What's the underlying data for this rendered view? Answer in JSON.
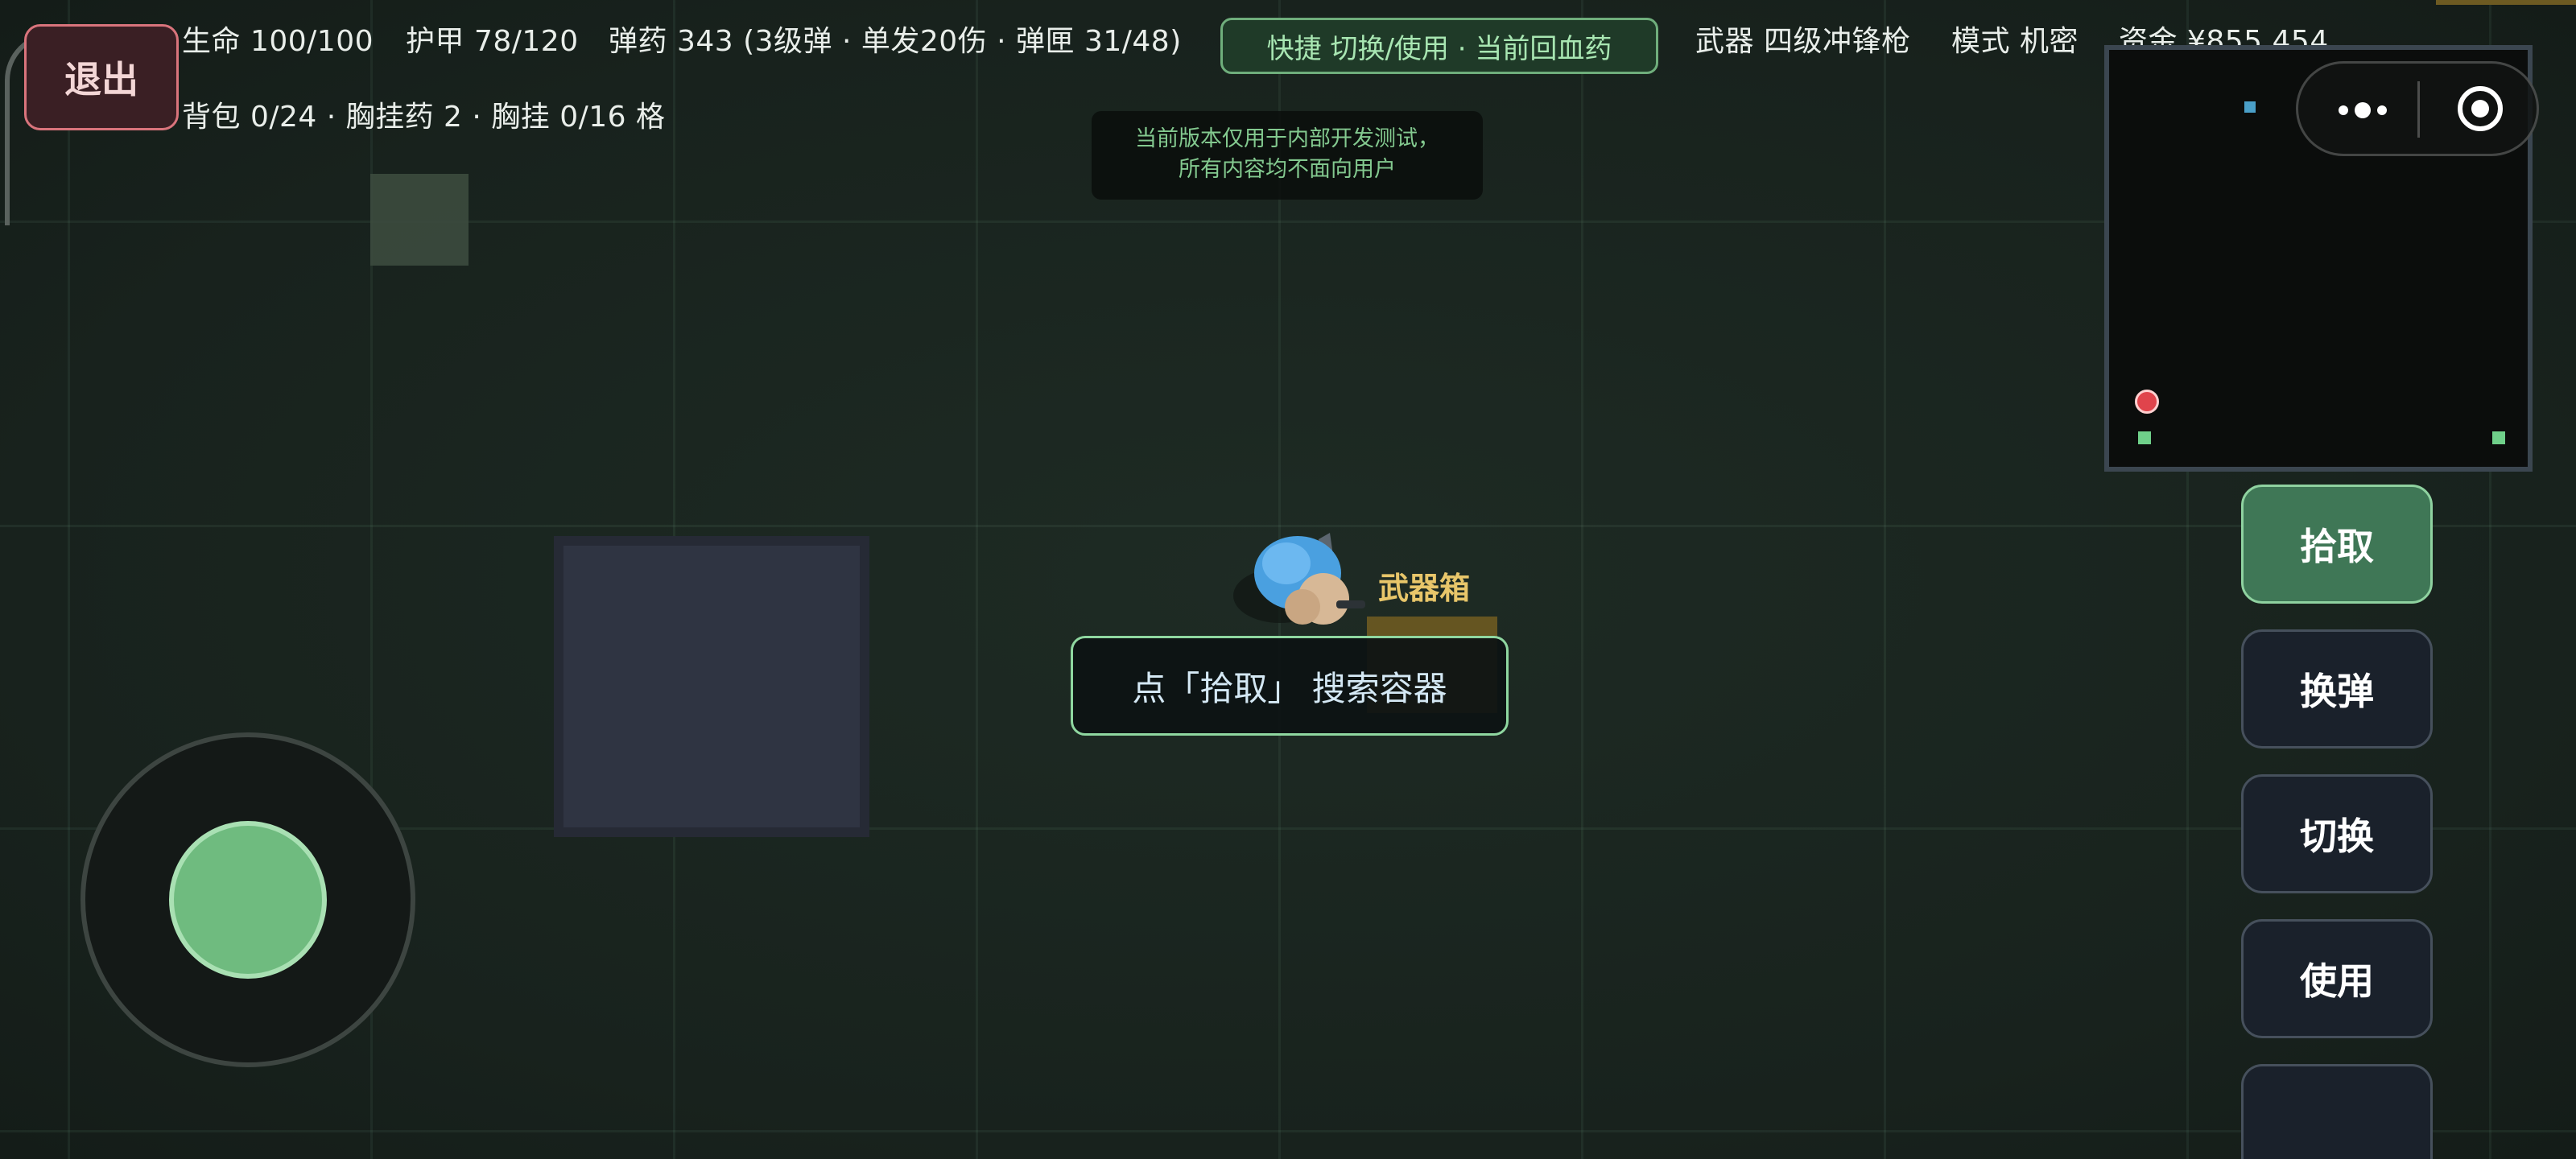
{
  "hud": {
    "health": "生命 100/100",
    "armor": "护甲 78/120",
    "ammo": "弹药 343 (3级弹 · 单发20伤 · 弹匣 31/48)",
    "weapon": "武器 四级冲锋枪",
    "mode": "模式 机密",
    "funds": "资金 ¥855,454",
    "inventory": "背包 0/24 · 胸挂药 2 · 胸挂 0/16 格"
  },
  "quick_action": "快捷 切换/使用 · 当前回血药",
  "exit_label": "退出",
  "dev_notice": {
    "line1": "当前版本仅用于内部开发测试，",
    "line2": "所有内容均不面向用户"
  },
  "world": {
    "crate_label": "武器箱",
    "prompt": "点「拾取」 搜索容器"
  },
  "actions": {
    "pickup": "拾取",
    "reload": "换弹",
    "switch": "切换",
    "use": "使用"
  },
  "colors": {
    "accent_green": "#6fbb7f",
    "exit_red": "#d9747c",
    "crate_gold": "#e8c66a",
    "background": "#1b2620"
  },
  "icons": {
    "menu": "more-dots-icon",
    "record": "target-icon"
  }
}
